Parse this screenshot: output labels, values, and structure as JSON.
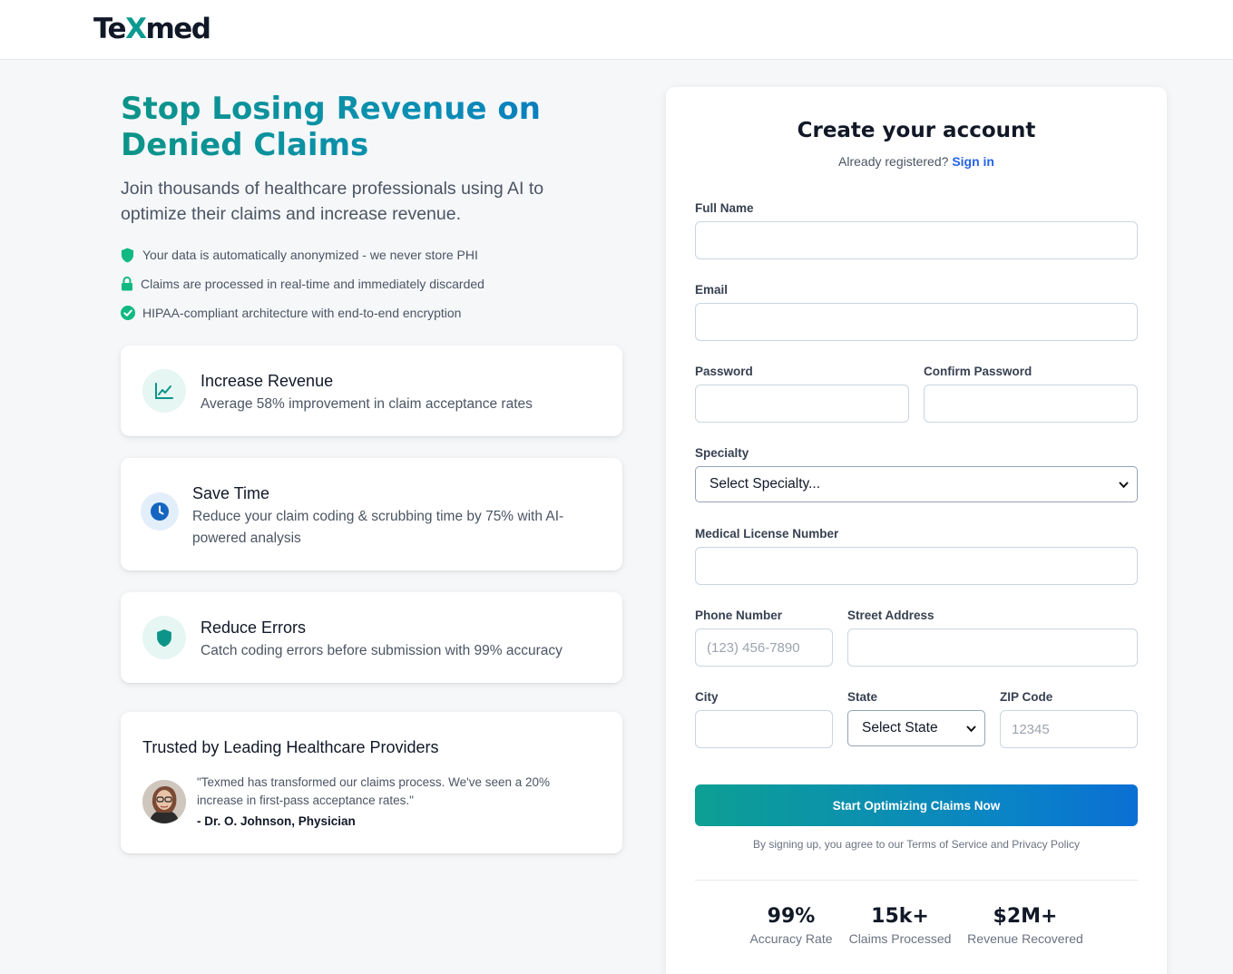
{
  "brand": {
    "name_prefix": "Te",
    "name_x": "X",
    "name_suffix": "med"
  },
  "hero": {
    "title": "Stop Losing Revenue on Denied Claims",
    "subtitle": "Join thousands of healthcare professionals using AI to optimize their claims and increase revenue.",
    "bullets": [
      {
        "icon": "shield-icon",
        "text": "Your data is automatically anonymized - we never store PHI"
      },
      {
        "icon": "lock-icon",
        "text": "Claims are processed in real-time and immediately discarded"
      },
      {
        "icon": "check-circle-icon",
        "text": "HIPAA-compliant architecture with end-to-end encryption"
      }
    ]
  },
  "features": [
    {
      "icon": "chart-line-icon",
      "title": "Increase Revenue",
      "desc": "Average 58% improvement in claim acceptance rates"
    },
    {
      "icon": "clock-icon",
      "title": "Save Time",
      "desc": "Reduce your claim coding & scrubbing time by 75% with AI-powered analysis"
    },
    {
      "icon": "shield-icon",
      "title": "Reduce Errors",
      "desc": "Catch coding errors before submission with 99% accuracy"
    }
  ],
  "testimonial": {
    "heading": "Trusted by Leading Healthcare Providers",
    "quote": "\"Texmed has transformed our claims process. We've seen a 20% increase in first-pass acceptance rates.\"",
    "author": "- Dr. O. Johnson, Physician"
  },
  "form": {
    "title": "Create your account",
    "signin_prompt": "Already registered?",
    "signin_link": "Sign in",
    "labels": {
      "full_name": "Full Name",
      "email": "Email",
      "password": "Password",
      "confirm_password": "Confirm Password",
      "specialty": "Specialty",
      "license": "Medical License Number",
      "phone": "Phone Number",
      "street": "Street Address",
      "city": "City",
      "state": "State",
      "zip": "ZIP Code"
    },
    "values": {
      "full_name": "",
      "email": "",
      "password": "",
      "confirm_password": "",
      "license": "",
      "phone": "",
      "street": "",
      "city": "",
      "zip": ""
    },
    "placeholders": {
      "phone": "(123) 456-7890",
      "zip": "12345"
    },
    "selects": {
      "specialty": "Select Specialty...",
      "state": "Select State"
    },
    "submit": "Start Optimizing Claims Now",
    "terms": "By signing up, you agree to our Terms of Service and Privacy Policy"
  },
  "stats": [
    {
      "value": "99%",
      "label": "Accuracy Rate"
    },
    {
      "value": "15k+",
      "label": "Claims Processed"
    },
    {
      "value": "$2M+",
      "label": "Revenue Recovered"
    }
  ],
  "colors": {
    "brand_teal": "#0d9488",
    "brand_blue": "#0b6fc7",
    "link_blue": "#2563eb",
    "icon_green": "#10b981"
  }
}
